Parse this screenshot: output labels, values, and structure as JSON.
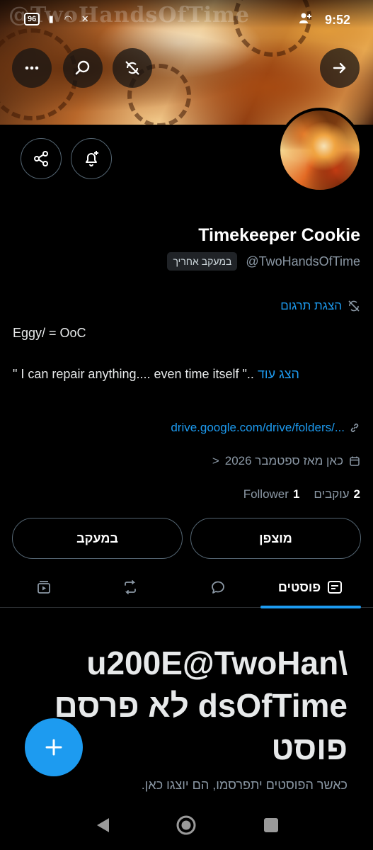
{
  "status_bar": {
    "watermark": "@TwoHandsOfTime",
    "battery": "96",
    "time": "9:52"
  },
  "banner_actions": {
    "more_icon": "more-icon",
    "search_icon": "search-icon",
    "sync_icon": "sync-off-icon",
    "forward_icon": "arrow-right-icon"
  },
  "profile": {
    "name": "Timekeeper Cookie",
    "handle": "@TwoHandsOfTime",
    "follows_you": "במעקב אחריך",
    "translate": "הצגת תרגום",
    "bio_line1": "Eggy/ = OoC",
    "bio_line2": "\" I can repair anything.... even time itself \"..",
    "bio_more": "הצג עוד",
    "link": "drive.google.com/drive/folders/...",
    "joined": "כאן מאז ספטמבר 2026",
    "joined_chevron": ">",
    "followers_count": "1",
    "followers_label": "Follower",
    "following_count": "2",
    "following_label": "עוקבים"
  },
  "buttons": {
    "following": "במעקב",
    "muted": "מוצפן"
  },
  "tabs": {
    "posts": "פוסטים"
  },
  "empty_state": {
    "title_line1": "u200E@TwoHan\\",
    "title_line2": "dsOfTime לא פרסם",
    "title_line3": "פוסט",
    "subtitle": "כאשר הפוסטים יתפרסמו, הם יוצגו כאן."
  },
  "colors": {
    "accent": "#1d9bf0",
    "background": "#000000",
    "muted_text": "#8b98a5"
  }
}
